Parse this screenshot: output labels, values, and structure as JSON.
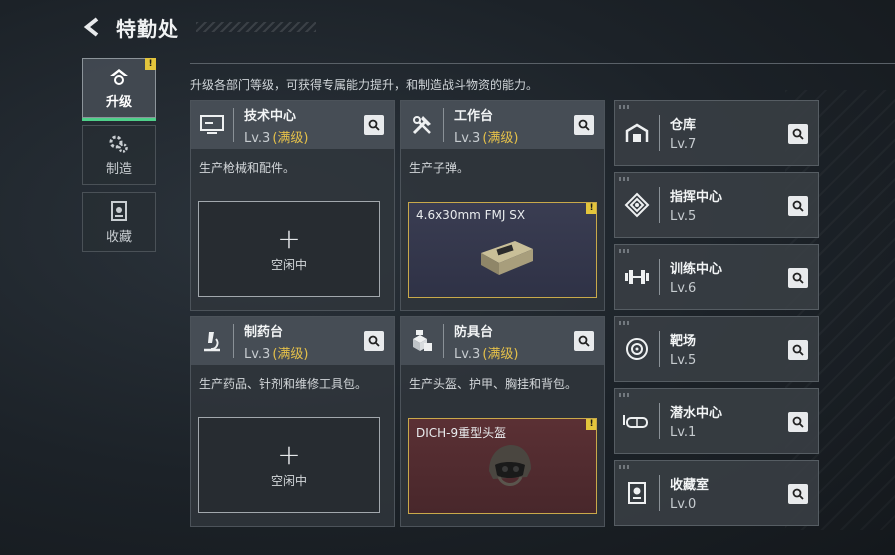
{
  "header": {
    "title": "特勤处"
  },
  "tabs": [
    {
      "label": "升级",
      "active": true,
      "badge": "!"
    },
    {
      "label": "制造",
      "active": false
    },
    {
      "label": "收藏",
      "active": false
    }
  ],
  "intro": "升级各部门等级，可获得专属能力提升，和制造战斗物资的能力。",
  "cards": [
    {
      "title": "技术中心",
      "level": "Lv.3",
      "status": "(满级)",
      "desc": "生产枪械和配件。",
      "slot": {
        "type": "empty",
        "plus": "+",
        "label": "空闲中"
      }
    },
    {
      "title": "工作台",
      "level": "Lv.3",
      "status": "(满级)",
      "desc": "生产子弹。",
      "slot": {
        "type": "item",
        "name": "4.6x30mm FMJ SX",
        "badge": "!"
      }
    },
    {
      "title": "制药台",
      "level": "Lv.3",
      "status": "(满级)",
      "desc": "生产药品、针剂和维修工具包。",
      "slot": {
        "type": "empty",
        "plus": "+",
        "label": "空闲中"
      }
    },
    {
      "title": "防具台",
      "level": "Lv.3",
      "status": "(满级)",
      "desc": "生产头盔、护甲、胸挂和背包。",
      "slot": {
        "type": "item",
        "name": "DICH-9重型头盔",
        "badge": "!"
      }
    }
  ],
  "facilities": [
    {
      "name": "仓库",
      "level": "Lv.7",
      "icon": "warehouse-icon"
    },
    {
      "name": "指挥中心",
      "level": "Lv.5",
      "icon": "command-icon"
    },
    {
      "name": "训练中心",
      "level": "Lv.6",
      "icon": "dumbbell-icon"
    },
    {
      "name": "靶场",
      "level": "Lv.5",
      "icon": "target-icon"
    },
    {
      "name": "潜水中心",
      "level": "Lv.1",
      "icon": "diving-mask-icon"
    },
    {
      "name": "收藏室",
      "level": "Lv.0",
      "icon": "collection-icon"
    }
  ],
  "colors": {
    "accent": "#4fd08a",
    "maxed": "#e5c14a",
    "badge": "#e3c53c"
  }
}
